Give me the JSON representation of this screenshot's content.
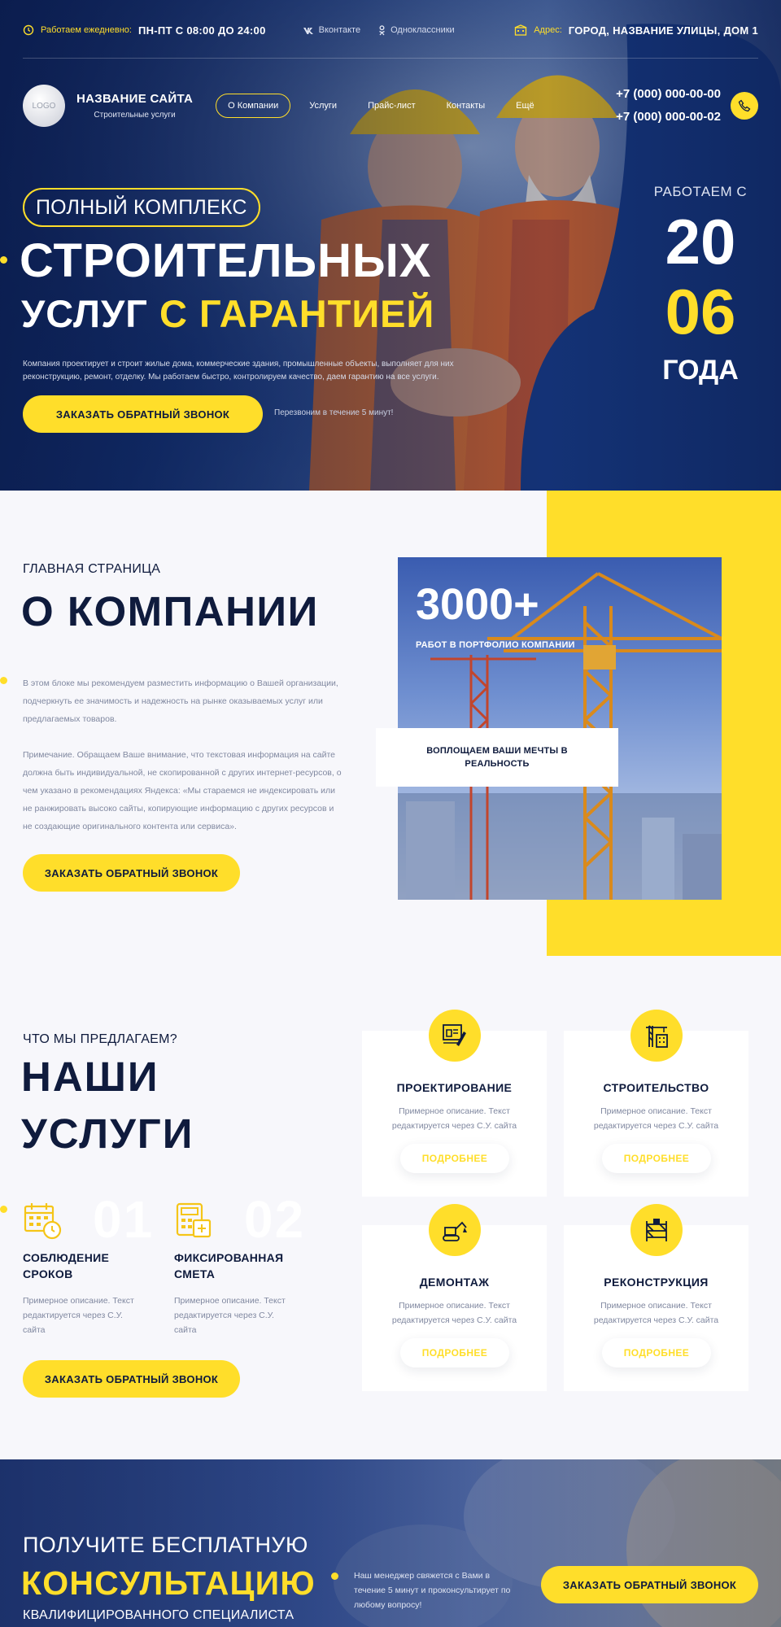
{
  "topbar": {
    "hours_label": "Работаем ежедневно:",
    "hours_value": "ПН-ПТ С 08:00 ДО 24:00",
    "social_vk": "Вконтакте",
    "social_ok": "Одноклассники",
    "address_label": "Адрес:",
    "address_value": "ГОРОД, НАЗВАНИЕ УЛИЦЫ, ДОМ 1"
  },
  "header": {
    "logo_text": "LOGO",
    "site_name": "НАЗВАНИЕ САЙТА",
    "site_sub": "Строительные услуги",
    "menu": [
      {
        "label": "О Компании"
      },
      {
        "label": "Услуги"
      },
      {
        "label": "Прайс-лист"
      },
      {
        "label": "Контакты"
      },
      {
        "label": "Ещё"
      }
    ],
    "phone_1": "+7 (000) 000-00-00",
    "phone_2": "+7 (000) 000-00-02"
  },
  "hero": {
    "pill": "ПОЛНЫЙ КОМПЛЕКС",
    "title_1": "СТРОИТЕЛЬНЫХ",
    "title_2a": "УСЛУГ ",
    "title_2b": "С ГАРАНТИЕЙ",
    "description": "Компания проектирует и строит жилые дома, коммерческие здания, промышленные объекты, выполняет для них реконструкцию, ремонт, отделку. Мы работаем быстро, контролируем качество, даем гарантию на все услуги.",
    "cta": "ЗАКАЗАТЬ ОБРАТНЫЙ ЗВОНОК",
    "cta_note": "Перезвоним в течение 5 минут!",
    "since_label": "РАБОТАЕМ С",
    "year_1": "20",
    "year_2": "06",
    "year_word": "ГОДА"
  },
  "about": {
    "kicker": "ГЛАВНАЯ СТРАНИЦА",
    "title": "О КОМПАНИИ",
    "p1": "В этом блоке мы рекомендуем разместить информацию о Вашей организации, подчеркнуть ее значимость и надежность на рынке оказываемых услуг или предлагаемых товаров.",
    "p2": "Примечание. Обращаем Ваше внимание, что текстовая информация на сайте должна быть индивидуальной, не скопированной с других интернет-ресурсов, о чем указано в рекомендациях Яндекса: «Мы стараемся не индексировать или не ранжировать высоко сайты, копирующие информацию с других ресурсов и не создающие оригинального контента или сервиса».",
    "cta": "ЗАКАЗАТЬ ОБРАТНЫЙ ЗВОНОК",
    "stat_value": "3000+",
    "stat_caption": "РАБОТ В ПОРТФОЛИО КОМПАНИИ",
    "card_text": "ВОПЛОЩАЕМ ВАШИ МЕЧТЫ В РЕАЛЬНОСТЬ"
  },
  "services": {
    "kicker": "ЧТО МЫ ПРЕДЛАГАЕМ?",
    "title_1": "НАШИ",
    "title_2": "УСЛУГИ",
    "features": [
      {
        "num": "01",
        "title": "СОБЛЮДЕНИЕ СРОКОВ",
        "desc": "Примерное описание. Текст редактируется через С.У. сайта",
        "icon": "calendar-clock-icon"
      },
      {
        "num": "02",
        "title": "ФИКСИРОВАННАЯ СМЕТА",
        "desc": "Примерное описание. Текст редактируется через С.У. сайта",
        "icon": "calculator-icon"
      }
    ],
    "cta": "ЗАКАЗАТЬ ОБРАТНЫЙ ЗВОНОК",
    "cards": [
      {
        "title": "ПРОЕКТИРОВАНИЕ",
        "desc": "Примерное описание. Текст редактируется через С.У. сайта",
        "more": "ПОДРОБНЕЕ",
        "icon": "blueprint-icon"
      },
      {
        "title": "СТРОИТЕЛЬСТВО",
        "desc": "Примерное описание. Текст редактируется через С.У. сайта",
        "more": "ПОДРОБНЕЕ",
        "icon": "crane-building-icon"
      },
      {
        "title": "ДЕМОНТАЖ",
        "desc": "Примерное описание. Текст редактируется через С.У. сайта",
        "more": "ПОДРОБНЕЕ",
        "icon": "excavator-icon"
      },
      {
        "title": "РЕКОНСТРУКЦИЯ",
        "desc": "Примерное описание. Текст редактируется через С.У. сайта",
        "more": "ПОДРОБНЕЕ",
        "icon": "scaffold-icon"
      }
    ]
  },
  "consult": {
    "line_1": "ПОЛУЧИТЕ БЕСПЛАТНУЮ",
    "line_2": "КОНСУЛЬТАЦИЮ",
    "line_3": "КВАЛИФИЦИРОВАННОГО СПЕЦИАЛИСТА",
    "note": "Наш менеджер свяжется с Вами в течение 5 минут и проконсультирует по любому вопросу!",
    "cta": "ЗАКАЗАТЬ ОБРАТНЫЙ ЗВОНОК"
  },
  "colors": {
    "accent": "#ffde2a",
    "navy": "#0f1b3d",
    "muted": "#8088a0"
  }
}
